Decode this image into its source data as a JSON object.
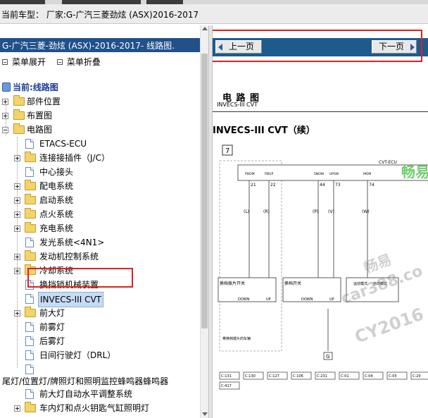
{
  "header": {
    "title": "当前车型：  厂家:G-广汽三菱劲炫 (ASX)2016-2017"
  },
  "left_panel": {
    "heading": "G-广汽三菱-劲炫 (ASX)-2016-2017- 线路图.",
    "expand_all": "菜单展开",
    "collapse_all": "菜单折叠",
    "current_label": "当前:线路图",
    "tree": {
      "top": [
        "部件位置",
        "布置图",
        "电路图"
      ],
      "circuit_children": [
        "ETACS-ECU",
        "连接接插件（J/C）",
        "中心接头",
        "配电系统",
        "启动系统",
        "点火系统",
        "充电系统",
        "发光系统<4N1>",
        "发动机控制系统",
        "冷却系统",
        "换挡锁机械装置",
        "INVECS-III CVT",
        "前大灯",
        "前雾灯",
        "后雾灯",
        "日间行驶灯（DRL）",
        "",
        "尾灯/位置灯/牌照灯和照明监控蜂鸣器蜂鸣器",
        "前大灯自动水平调整系统",
        "车内灯和点火钥匙气缸照明灯"
      ],
      "selected": "INVECS-III CVT"
    }
  },
  "right_panel": {
    "prev_button": "上一页",
    "next_button": "下一页",
    "doc_title": "电 路 图",
    "doc_subtitle": "INVECS-III CVT",
    "doc_heading": "INVECS-III CVT（续）",
    "page_number": "7",
    "ecu_label": "CVT-ECU",
    "pin_labels": [
      "PDOM",
      "PDUP",
      "SNOW",
      "UPSW",
      "MOM"
    ],
    "pin_numbers": [
      "21",
      "22",
      "44",
      "73",
      "74"
    ],
    "connector_ids": [
      "C-131",
      "C-130",
      "C-127",
      "C-106",
      "C-231",
      "C-01",
      "C-04",
      "C-05",
      "C-20",
      "C-108",
      "C-127",
      "C-417"
    ],
    "wire_colors": [
      "(L)",
      "(R)",
      "(P)",
      "(V)",
      "(W)",
      "(B)"
    ],
    "switch_labels": [
      "换档拨片开关",
      "换档开关",
      "运动模式",
      "自动模式"
    ],
    "switch_legend": [
      "DOWN",
      "UP"
    ],
    "ground_label": "G",
    "note": "带换档拨片的车辆",
    "watermarks": [
      "畅易",
      "car388.co",
      "CY2016",
      "畅易"
    ]
  },
  "colors": {
    "left_heading_bg": "#21508a",
    "nav_bar_bg": "#1d5a8e",
    "highlight_box": "#e02020",
    "current_label": "#1b3d8f",
    "selected_bg": "#c6dbf5",
    "watermark_green": "#3cbe3c"
  },
  "icons": [
    "folder-icon",
    "document-icon",
    "expand-icon",
    "collapse-icon",
    "computer-icon",
    "arrow-left-icon",
    "arrow-right-icon"
  ]
}
